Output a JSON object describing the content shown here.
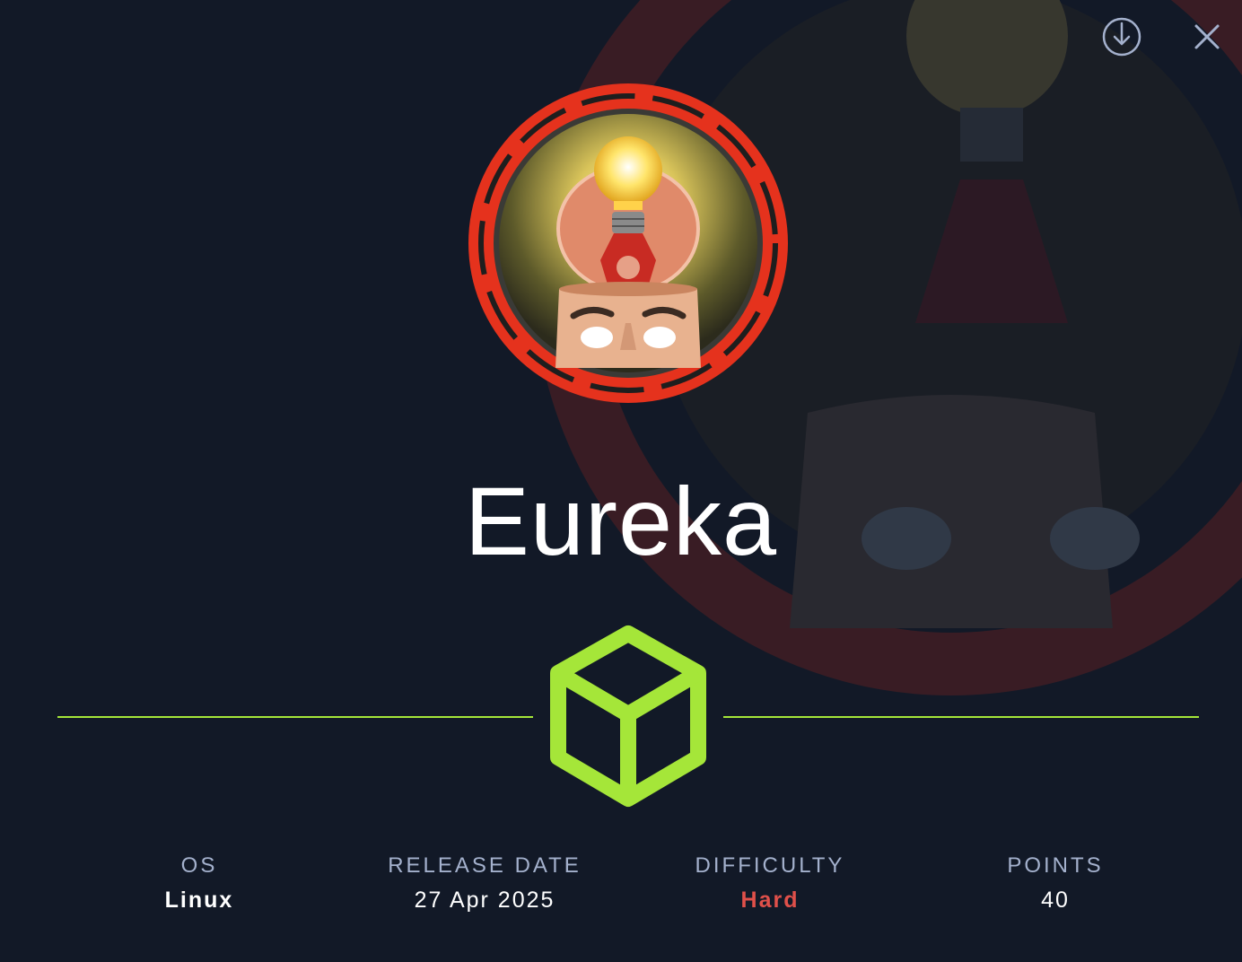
{
  "machine": {
    "name": "Eureka"
  },
  "toolbar": {
    "download_icon": "download-circle-icon",
    "close_icon": "close-icon"
  },
  "stats": {
    "os_label": "OS",
    "os_value": "Linux",
    "release_label": "RELEASE DATE",
    "release_value": "27 Apr 2025",
    "difficulty_label": "DIFFICULTY",
    "difficulty_value": "Hard",
    "points_label": "POINTS",
    "points_value": "40"
  },
  "colors": {
    "background": "#121927",
    "accent_green": "#a5e639",
    "difficulty_hard": "#e0504a",
    "label_gray": "#a4b1cd",
    "avatar_ring": "#e5321d"
  }
}
